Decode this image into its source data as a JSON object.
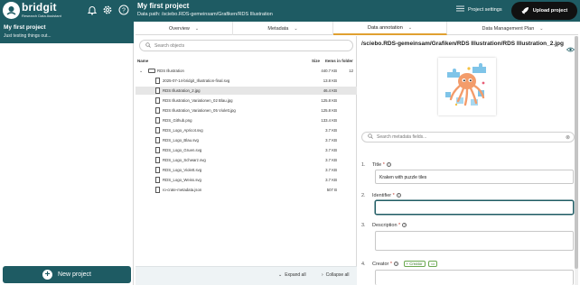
{
  "topbar": {
    "brand": "bridgit",
    "brand_sub": "Research Data Assistant",
    "project_title": "My first project",
    "data_path": "Data path: /sciebo.RDS-gemeinsam/Grafiken/RDS Illustration",
    "settings_label": "Project settings",
    "upload_label": "Upload project",
    "icons": [
      "bell-icon",
      "gear-icon",
      "help-icon"
    ]
  },
  "sidebar": {
    "project_name": "My first project",
    "project_desc": "Just testing things out...",
    "new_project_label": "New project"
  },
  "tabs": [
    {
      "label": "Overview",
      "active": false
    },
    {
      "label": "Metadata",
      "active": false
    },
    {
      "label": "Data annotation",
      "active": true
    },
    {
      "label": "Data Management Plan",
      "active": false
    }
  ],
  "files": {
    "search_placeholder": "Search objects",
    "columns": {
      "name": "Name",
      "size": "Size",
      "items": "Items in folder"
    },
    "folder": {
      "name": "RDS Illustration",
      "size": "440.7 KB",
      "items": "12"
    },
    "rows": [
      {
        "name": "2025-07-14-bridgit_Illustration-final.svg",
        "size": "13.8 KB",
        "selected": false
      },
      {
        "name": "RDS Illustration_2.jpg",
        "size": "46.4 KB",
        "selected": true
      },
      {
        "name": "RDS Illustration_Variationen_02 Blau.jpg",
        "size": "125.8 KB",
        "selected": false
      },
      {
        "name": "RDS Illustration_Variationen_05 Violett.jpg",
        "size": "125.8 KB",
        "selected": false
      },
      {
        "name": "RDS_Github.png",
        "size": "133.4 KB",
        "selected": false
      },
      {
        "name": "RDS_Logo_Apricot.svg",
        "size": "3.7 KB",
        "selected": false
      },
      {
        "name": "RDS_Logo_Blau.svg",
        "size": "3.7 KB",
        "selected": false
      },
      {
        "name": "RDS_Logo_Gruen.svg",
        "size": "3.7 KB",
        "selected": false
      },
      {
        "name": "RDS_Logo_Schwarz.svg",
        "size": "3.7 KB",
        "selected": false
      },
      {
        "name": "RDS_Logo_Violett.svg",
        "size": "3.7 KB",
        "selected": false
      },
      {
        "name": "RDS_Logo_Weiss.svg",
        "size": "3.7 KB",
        "selected": false
      },
      {
        "name": "ro-crate-metadata.json",
        "size": "507 B",
        "selected": false
      }
    ],
    "expand_label": "Expand all",
    "collapse_label": "Collapse all"
  },
  "annotation": {
    "file_path": "/sciebo.RDS-gemeinsam/Grafiken/RDS Illustration/RDS Illustration_2.jpg",
    "search_placeholder": "Search metadata fields...",
    "fields": [
      {
        "num": "1.",
        "label": "Title",
        "value": ""
      },
      {
        "num": "2.",
        "label": "Identifier",
        "value": ""
      },
      {
        "num": "3.",
        "label": "Description",
        "value": ""
      },
      {
        "num": "4.",
        "label": "Creator",
        "value": ""
      }
    ],
    "title_value": "Kraken with puzzle tiles",
    "creator_chip": "+ Creator"
  },
  "colors": {
    "brand": "#1e5b63",
    "accent_tab": "#e0a030",
    "upload_bg": "#111111"
  }
}
